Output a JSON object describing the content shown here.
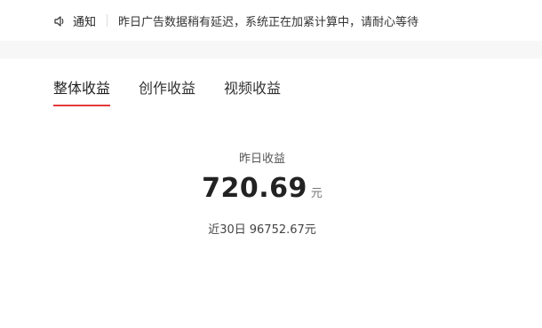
{
  "notice": {
    "icon": "speaker-icon",
    "title": "通知",
    "text": "昨日广告数据稍有延迟，系统正在加紧计算中，请耐心等待"
  },
  "tabs": [
    {
      "label": "整体收益",
      "active": true
    },
    {
      "label": "创作收益",
      "active": false
    },
    {
      "label": "视频收益",
      "active": false
    }
  ],
  "stats": {
    "yesterday_label": "昨日收益",
    "yesterday_value": "720.69",
    "unit": "元",
    "recent_label": "近30日",
    "recent_value": "96752.67元"
  },
  "colors": {
    "accent": "#e4393c",
    "band": "#f7f7f7"
  }
}
